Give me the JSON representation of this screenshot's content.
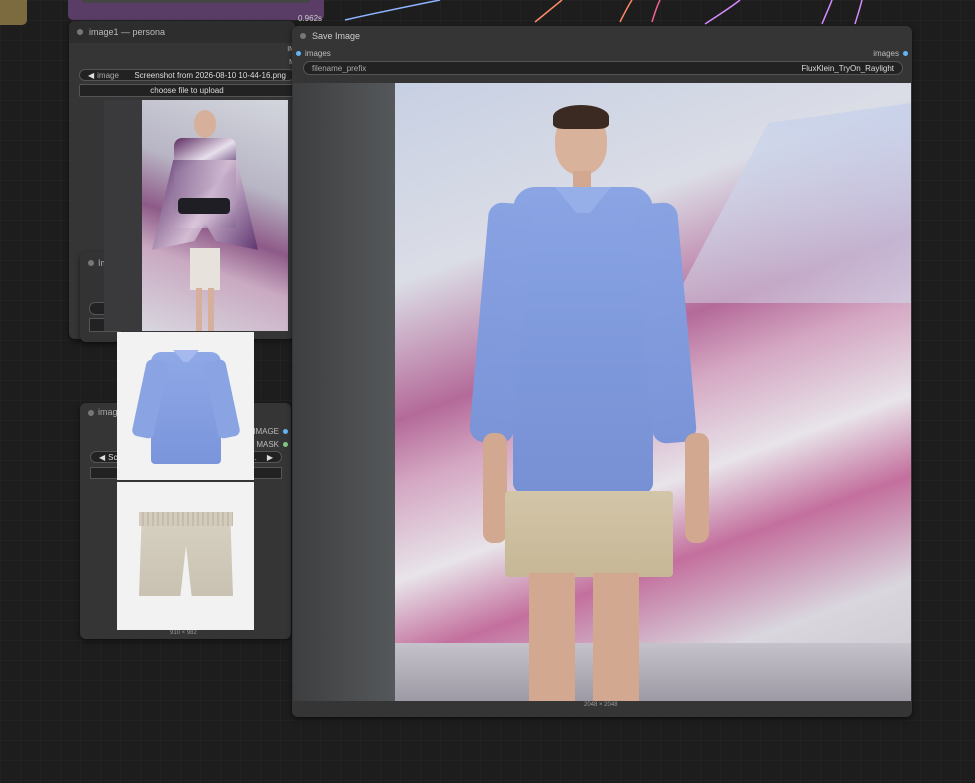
{
  "colors": {
    "canvas": "#1d1d1d",
    "node_body": "#353535",
    "node_title": "#2d2d2d",
    "purple_node": "#5a3d67",
    "image_port": "#64b5f6",
    "mask_port": "#81c784",
    "link_blue": "#8fb4ff",
    "link_orange": "#ff8a65",
    "link_pink": "#f06292",
    "link_violet": "#d68cff"
  },
  "timing_badge": "0.962s",
  "node_persona": {
    "title": "image1 — persona",
    "partial_output_1": "IM",
    "partial_output_2": "M",
    "image_label": "image",
    "filename": "Screenshot from 2026-08-10 10-44-16.png",
    "upload_label": "choose file to upload",
    "arrow_left": "◀"
  },
  "node_hidden": {
    "title_partial": "Im"
  },
  "node_image2": {
    "title_partial": "imag",
    "output_image": "IMAGE",
    "output_mask": "MASK",
    "filename_partial": "Scre",
    "arrow_left": "◀",
    "arrow_right": "▶",
    "ellipsis": "...",
    "dimensions": "910 × 982"
  },
  "node_save": {
    "title": "Save Image",
    "input_images": "images",
    "output_images": "images",
    "filename_prefix_label": "filename_prefix",
    "filename_prefix_value": "FluxKlein_TryOn_Raylight",
    "dimensions": "2048 × 2048"
  },
  "icons": {
    "persona_photo": "runway-model-kimono-photo",
    "shirt_photo": "blue-shirt-product-photo",
    "shorts_photo": "beige-shorts-product-photo",
    "result_photo": "runway-model-blue-shirt-photo"
  }
}
